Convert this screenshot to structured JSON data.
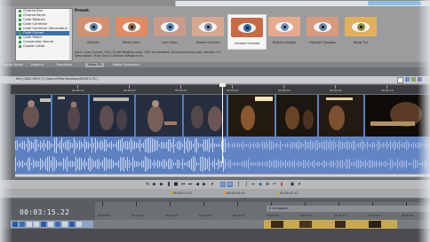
{
  "video_fx": {
    "plugins": [
      "Chroma Blur",
      "Chroma Keyer",
      "Color Balance",
      "Color Corrector",
      "Color Corrector (Secondary)",
      "Color Curves",
      "Color Match",
      "Convolution Kernel",
      "Cookie Cutter"
    ],
    "selected_plugin": "Color Curves",
    "presets_label": "Preset:",
    "presets": [
      {
        "label": "(Default)",
        "lid": "#d2906e",
        "iris": "#5c7fa3"
      },
      {
        "label": "Warm Colors",
        "lid": "#e18a62",
        "iris": "#8b6a4a"
      },
      {
        "label": "Cool Colors",
        "lid": "#c99a8a",
        "iris": "#4e8cc0"
      },
      {
        "label": "Reduce Contrast",
        "lid": "#d7a790",
        "iris": "#7a8fa8"
      },
      {
        "label": "Increase Contrast",
        "lid": "#c86a44",
        "iris": "#2f6aa8"
      },
      {
        "label": "Brighten Brights",
        "lid": "#e8aa8c",
        "iris": "#6a93c4"
      },
      {
        "label": "Highlight Shadows",
        "lid": "#d89a7c",
        "iris": "#6b84a0"
      },
      {
        "label": "Yellow Tint",
        "lid": "#e3b05a",
        "iris": "#8d8a40"
      }
    ],
    "selected_preset": "Increase Contrast",
    "description_line1": "Sony Color Curves: OFX, 32-bit floating point, GPU Accelerated, Grouping Sony.Color, Version 1.0",
    "description_line2": "Description: From Sony Creative Software Inc.",
    "tabs": [
      "Project Media",
      "Explorer",
      "Transitions",
      "Video FX",
      "Media Generators"
    ],
    "active_tab": "Video FX"
  },
  "trimmer": {
    "file_path": "MVI_0605.MOV  [C:\\Users\\FMar\\Desktop\\SONY-L\\TC]",
    "ruler_labels": [
      "00:00:10",
      "00:00:20",
      "00:00:30",
      "00:00:40",
      "00:00:50",
      "00:01:00",
      "00:01:10",
      "00:01:20"
    ],
    "selection_start": "00:00:11.00",
    "selection_end": "00:00:24.00",
    "selection_length": "00:00:41.12"
  },
  "timeline": {
    "timecode": "00:03:15.22",
    "ruler_labels": [
      "00:00:00",
      "00:00:10",
      "00:00:20",
      "00:00:30",
      "00:00:40",
      "00:00:50",
      "00:01:00",
      "00:01:10",
      "00:01:20",
      "00:01:30"
    ],
    "loop_label": "8 schnappen"
  },
  "colors": {
    "audio_blue": "#5d80c1",
    "selection_blue": "#3a6fb0",
    "clip_gold": "#c7a94e",
    "plugin_green": "#33a047"
  }
}
